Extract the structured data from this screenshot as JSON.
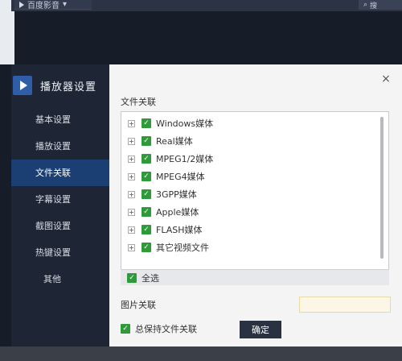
{
  "background_app": {
    "title": "百度影音",
    "search_label": "搜"
  },
  "sidebar": {
    "title": "播放器设置",
    "items": [
      {
        "label": "基本设置"
      },
      {
        "label": "播放设置"
      },
      {
        "label": "文件关联",
        "active": true
      },
      {
        "label": "字幕设置"
      },
      {
        "label": "截图设置"
      },
      {
        "label": "热键设置"
      },
      {
        "label": "其他"
      }
    ]
  },
  "panel": {
    "close": "×",
    "file_assoc_title": "文件关联",
    "file_types": [
      {
        "label": "Windows媒体",
        "checked": true
      },
      {
        "label": "Real媒体",
        "checked": true
      },
      {
        "label": "MPEG1/2媒体",
        "checked": true
      },
      {
        "label": "MPEG4媒体",
        "checked": true
      },
      {
        "label": "3GPP媒体",
        "checked": true
      },
      {
        "label": "Apple媒体",
        "checked": true
      },
      {
        "label": "FLASH媒体",
        "checked": true
      },
      {
        "label": "其它视频文件",
        "checked": true
      }
    ],
    "select_all": {
      "label": "全选",
      "checked": true
    },
    "image_assoc_title": "图片关联",
    "keep_assoc": {
      "label": "总保持文件关联",
      "checked": true
    },
    "ok_label": "确定"
  },
  "colors": {
    "sidebar_bg": "#1e2535",
    "active_item": "#1c3f73",
    "checkbox_green": "#2f9a3a",
    "panel_bg": "#f4f4f5"
  }
}
